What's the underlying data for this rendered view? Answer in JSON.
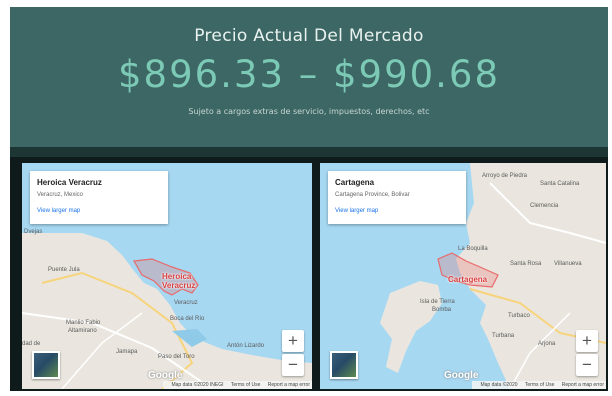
{
  "header": {
    "title": "Precio Actual Del Mercado",
    "price": "$896.33 – $990.68",
    "note": "Sujeto a cargos extras de servicio, impuestos, derechos, etc"
  },
  "maps": [
    {
      "card": {
        "name": "Heroica Veracruz",
        "subtitle": "Veracruz, Mexico",
        "link": "View larger map"
      },
      "city_label": [
        "Heroica",
        "Veracruz"
      ],
      "places": [
        "Dvejas",
        "Puente Jula",
        "Veracruz",
        "Boca del Río",
        "Manlio Fabio",
        "Altamirano",
        "dad de",
        "Jamapa",
        "Paso del Toro",
        "Antón Lizardo"
      ],
      "zoom_in": "+",
      "zoom_out": "−",
      "google": "Google",
      "attribution": {
        "data": "Map data ©2020 INEGI",
        "terms": "Terms of Use",
        "report": "Report a map error"
      }
    },
    {
      "card": {
        "name": "Cartagena",
        "subtitle": "Cartagena Province, Bolivar",
        "link": "View larger map"
      },
      "city_label": [
        "Cartagena"
      ],
      "places": [
        "Arroyo de Piedra",
        "Santa Catalina",
        "Clemencia",
        "La Boquilla",
        "Santa Rosa",
        "Villanueva",
        "Isla de Tierra",
        "Bomba",
        "Turbaco",
        "Turbana",
        "Arjona"
      ],
      "zoom_in": "+",
      "zoom_out": "−",
      "google": "Google",
      "attribution": {
        "data": "Map data ©2020",
        "terms": "Terms of Use",
        "report": "Report a map error"
      }
    }
  ],
  "colors": {
    "header_bg": "#3c6765",
    "price": "#7ccab6",
    "water": "#a7d8f2",
    "land": "#eae6df",
    "boundary": "#e86a6a"
  }
}
